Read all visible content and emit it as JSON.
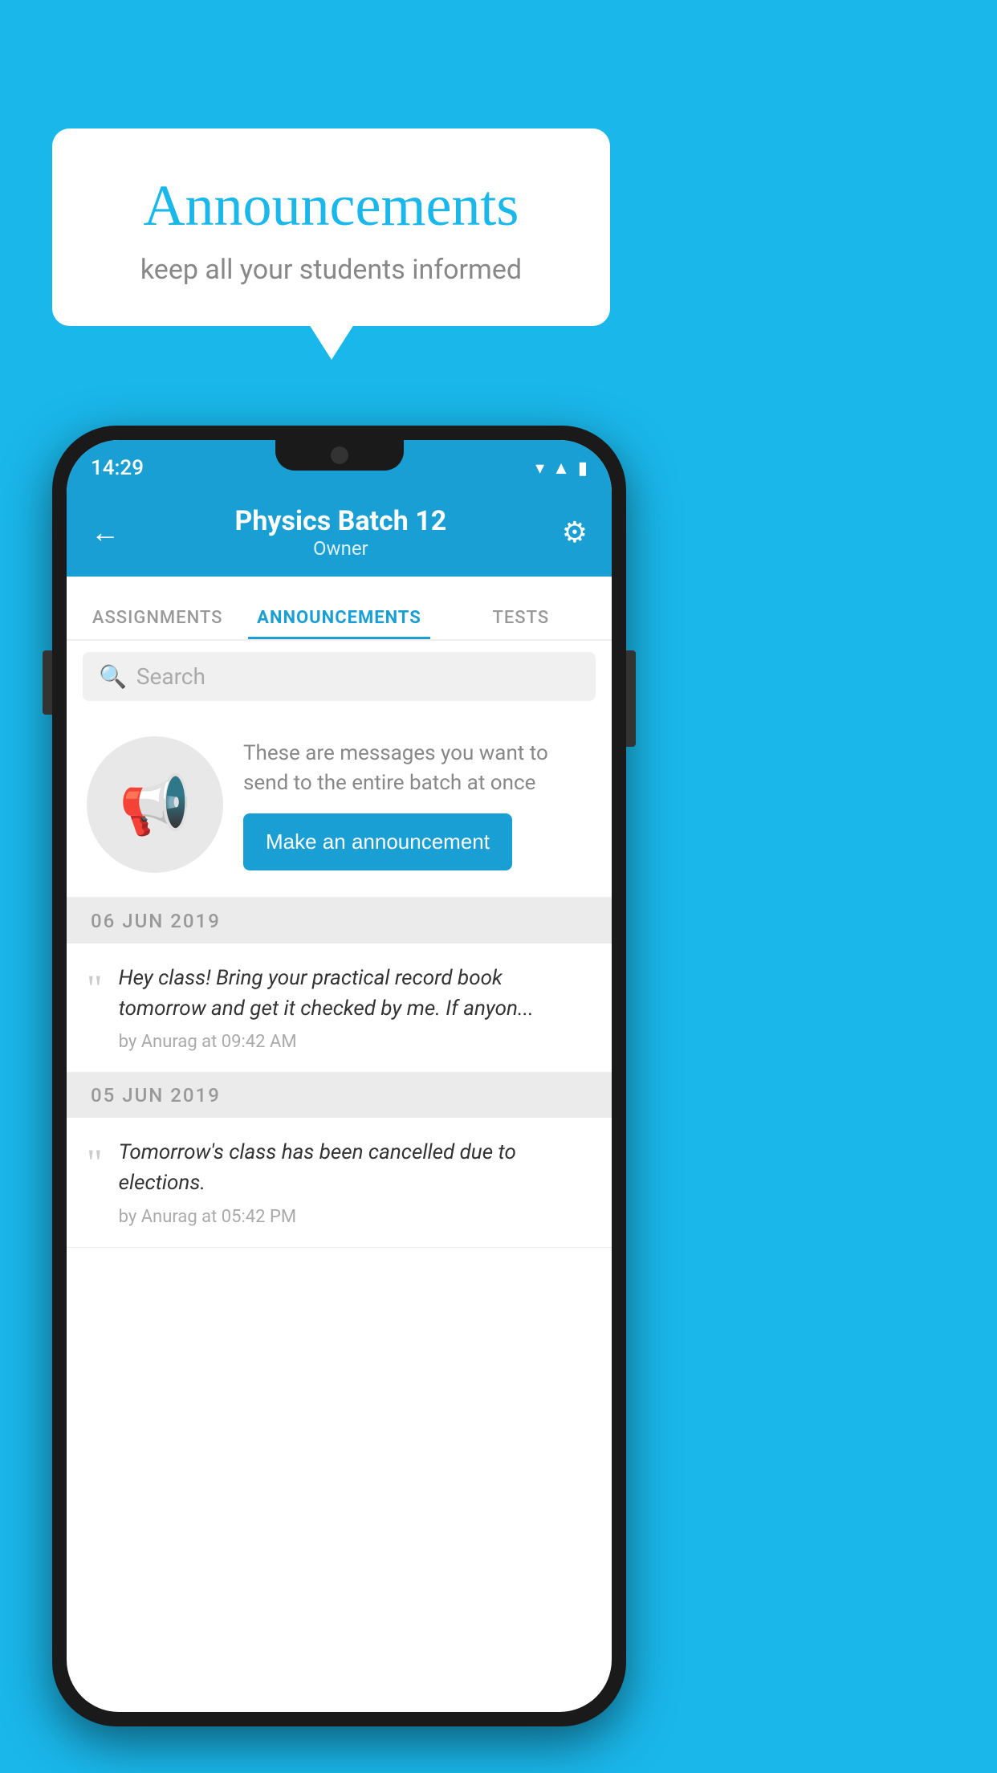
{
  "background_color": "#1ab7ea",
  "speech_bubble": {
    "title": "Announcements",
    "subtitle": "keep all your students informed"
  },
  "phone": {
    "status_bar": {
      "time": "14:29",
      "icons": [
        "wifi",
        "signal",
        "battery"
      ]
    },
    "header": {
      "title": "Physics Batch 12",
      "subtitle": "Owner",
      "back_label": "←",
      "gear_label": "⚙"
    },
    "tabs": [
      {
        "label": "ASSIGNMENTS",
        "active": false
      },
      {
        "label": "ANNOUNCEMENTS",
        "active": true
      },
      {
        "label": "TESTS",
        "active": false
      }
    ],
    "search": {
      "placeholder": "Search"
    },
    "cta_section": {
      "description": "These are messages you want to send to the entire batch at once",
      "button_label": "Make an announcement"
    },
    "announcements": [
      {
        "date": "06  JUN  2019",
        "text": "Hey class! Bring your practical record book tomorrow and get it checked by me. If anyon...",
        "meta": "by Anurag at 09:42 AM"
      },
      {
        "date": "05  JUN  2019",
        "text": "Tomorrow's class has been cancelled due to elections.",
        "meta": "by Anurag at 05:42 PM"
      }
    ]
  }
}
